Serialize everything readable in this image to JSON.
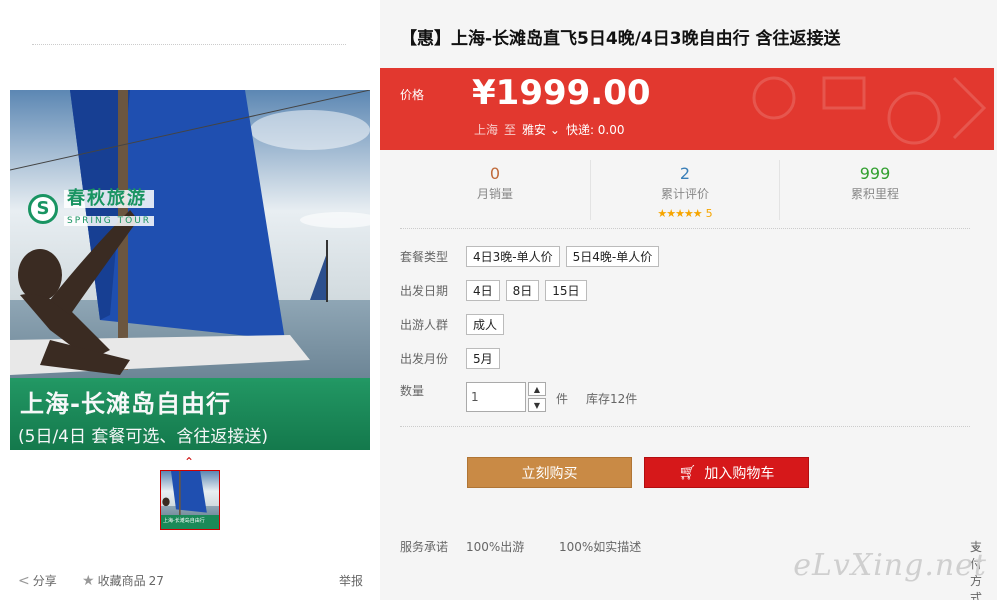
{
  "product": {
    "title": "【惠】上海-长滩岛直飞5日4晚/4日3晚自由行 含往返接送",
    "image_banner_line1": "上海-长滩岛自由行",
    "image_banner_line2": "(5日/4日 套餐可选、含往返接送)",
    "thumb_caption": "上海-长滩岛自由行",
    "logo_cn": "春秋旅游",
    "logo_en": "SPRING TOUR"
  },
  "price": {
    "label": "价格",
    "value": "¥1999.00",
    "from": "上海",
    "to_word": "至",
    "destination": "雅安",
    "shipping": "快递: 0.00"
  },
  "stats": [
    {
      "value": "0",
      "label": "月销量"
    },
    {
      "value": "2",
      "label": "累计评价",
      "stars": "★★★★★",
      "rating": "5"
    },
    {
      "value": "999",
      "label": "累积里程"
    }
  ],
  "options": [
    {
      "label": "套餐类型",
      "values": [
        "4日3晚-单人价",
        "5日4晚-单人价"
      ]
    },
    {
      "label": "出发日期",
      "values": [
        "4日",
        "8日",
        "15日"
      ]
    },
    {
      "label": "出游人群",
      "values": [
        "成人"
      ]
    },
    {
      "label": "出发月份",
      "values": [
        "5月"
      ]
    }
  ],
  "quantity": {
    "label": "数量",
    "value": "1",
    "unit": "件",
    "stock": "库存12件"
  },
  "buttons": {
    "buy_now": "立刻购买",
    "add_to_cart": "加入购物车"
  },
  "service": {
    "label": "服务承诺",
    "item1": "100%出游",
    "item2": "100%如实描述",
    "payment": "支付方式"
  },
  "left_bar": {
    "share": "分享",
    "favorite": "收藏商品",
    "favorite_count": "27",
    "report": "举报"
  },
  "watermark": "eLvXing.net",
  "colors": {
    "price_red": "#e2382f",
    "buy_brown": "#c98a45",
    "cart_red": "#d6181a",
    "banner_green": "#1f9a62"
  }
}
